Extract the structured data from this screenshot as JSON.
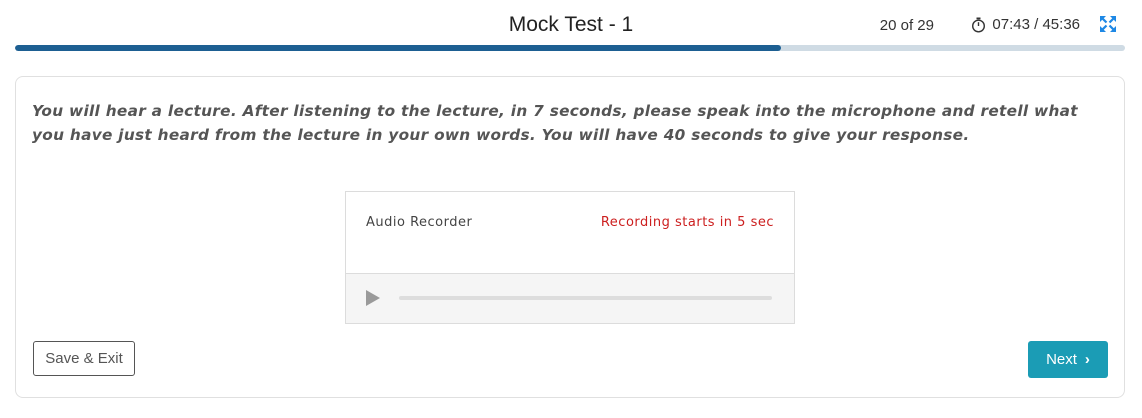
{
  "header": {
    "title": "Mock Test - 1",
    "question_progress": "20 of 29",
    "timer": "07:43 / 45:36",
    "progress_fraction": 0.69
  },
  "question": {
    "instruction": "You will hear a lecture. After listening to the lecture, in 7 seconds, please speak into the microphone and retell what you have just heard from the lecture in your own words. You will have 40 seconds to give your response."
  },
  "recorder": {
    "label": "Audio Recorder",
    "status": "Recording starts in 5 sec"
  },
  "buttons": {
    "save_exit": "Save & Exit",
    "next": "Next"
  },
  "icons": {
    "timer": "stopwatch-icon",
    "expand": "fullscreen-icon",
    "play": "play-icon",
    "next": "chevron-right-icon"
  },
  "colors": {
    "progress_fill": "#1d5f92",
    "progress_track": "#cfdbe4",
    "next_button": "#1b9cb5",
    "status_red": "#cc1f1f",
    "fullscreen_icon": "#1e88e5"
  }
}
